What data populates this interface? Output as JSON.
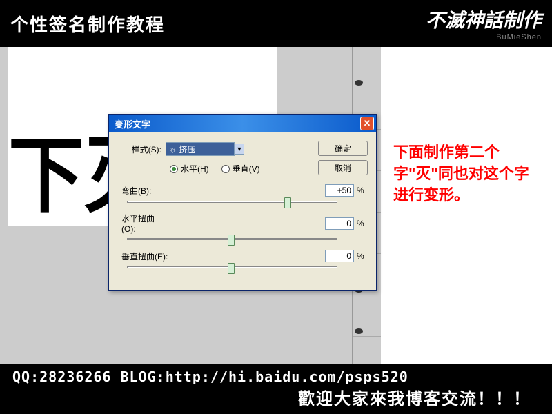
{
  "banner": {
    "title": "个性签名制作教程",
    "logo_main": "不滅神話制作",
    "logo_sub": "BuMieShen"
  },
  "canvas_text": "下灭",
  "instruction": "下面制作第二个字\"灭\"同也对这个字进行变形。",
  "dialog": {
    "title": "变形文字",
    "style_label": "样式(S):",
    "style_value": "挤压",
    "radio_h": "水平(H)",
    "radio_v": "垂直(V)",
    "radio_checked": "h",
    "bend_label": "弯曲(B):",
    "bend_value": "+50",
    "hdist_label": "水平扭曲(O):",
    "hdist_value": "0",
    "vdist_label": "垂直扭曲(E):",
    "vdist_value": "0",
    "pct": "%",
    "ok": "确定",
    "cancel": "取消",
    "close_x": "✕"
  },
  "footer": {
    "line1": "QQ:28236266  BLOG:http://hi.baidu.com/psps520",
    "line2": "歡迎大家來我博客交流！！！"
  }
}
